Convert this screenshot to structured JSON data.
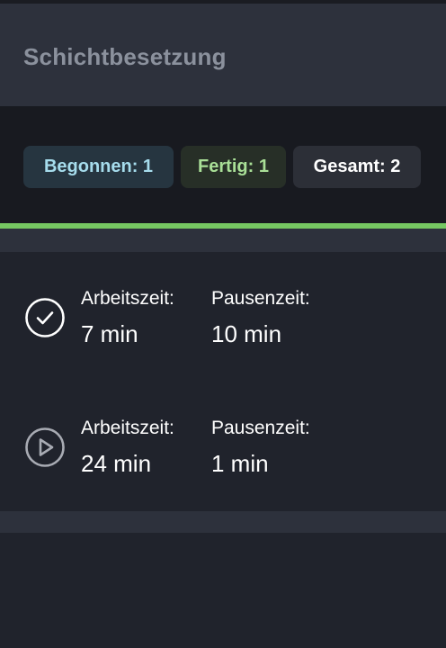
{
  "header": {
    "title": "Schichtbesetzung"
  },
  "stats": {
    "started": "Begonnen: 1",
    "done": "Fertig: 1",
    "total": "Gesamt: 2"
  },
  "progress": {
    "fraction": 1.0
  },
  "entries": [
    {
      "status_icon": "check-circle-icon",
      "work_label": "Arbeitszeit:",
      "work_value": "7 min",
      "break_label": "Pausenzeit:",
      "break_value": "10 min"
    },
    {
      "status_icon": "play-circle-icon",
      "work_label": "Arbeitszeit:",
      "work_value": "24 min",
      "break_label": "Pausenzeit:",
      "break_value": "1 min"
    }
  ],
  "colors": {
    "progress": "#76c862",
    "started_text": "#a6dcec",
    "done_text": "#a9df97"
  }
}
